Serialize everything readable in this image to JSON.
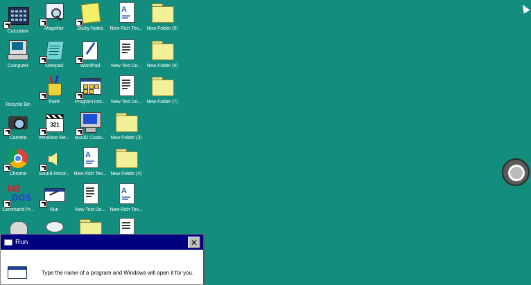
{
  "desktop": {
    "icons": [
      {
        "label": "Calculator"
      },
      {
        "label": "Computer"
      },
      {
        "label": "Recycle Bin"
      },
      {
        "label": "Camera"
      },
      {
        "label": "Chrome"
      },
      {
        "label": "Command Pr..."
      },
      {
        "label": "Magnifier"
      },
      {
        "label": "Notepad"
      },
      {
        "label": "Paint"
      },
      {
        "label": "Windows Me..."
      },
      {
        "label": "Sound Recor..."
      },
      {
        "label": "Run"
      },
      {
        "label": "Sticky Notes"
      },
      {
        "label": "WordPad"
      },
      {
        "label": "Program Inst..."
      },
      {
        "label": "BSOD Custo..."
      },
      {
        "label": "New Rich Tex..."
      },
      {
        "label": "New Text Do..."
      },
      {
        "label": "New Rich Tex..."
      },
      {
        "label": "New Text Do..."
      },
      {
        "label": "New Text Do..."
      },
      {
        "label": "New Folder (3)"
      },
      {
        "label": "New Folder (4)"
      },
      {
        "label": "New Rich Tex..."
      },
      {
        "label": "New Folder (5)"
      },
      {
        "label": "New Folder (6)"
      },
      {
        "label": "New Folder (7)"
      }
    ]
  },
  "media_label": "321",
  "msdos": {
    "line1": "MS",
    "line2": "DOS"
  },
  "run_dialog": {
    "title": "Run",
    "close": "✕",
    "prompt": "Type the name of a program and Windows will open it for you."
  },
  "colors": {
    "desktop_background": "#128d7e",
    "title_bar": "#000080"
  }
}
